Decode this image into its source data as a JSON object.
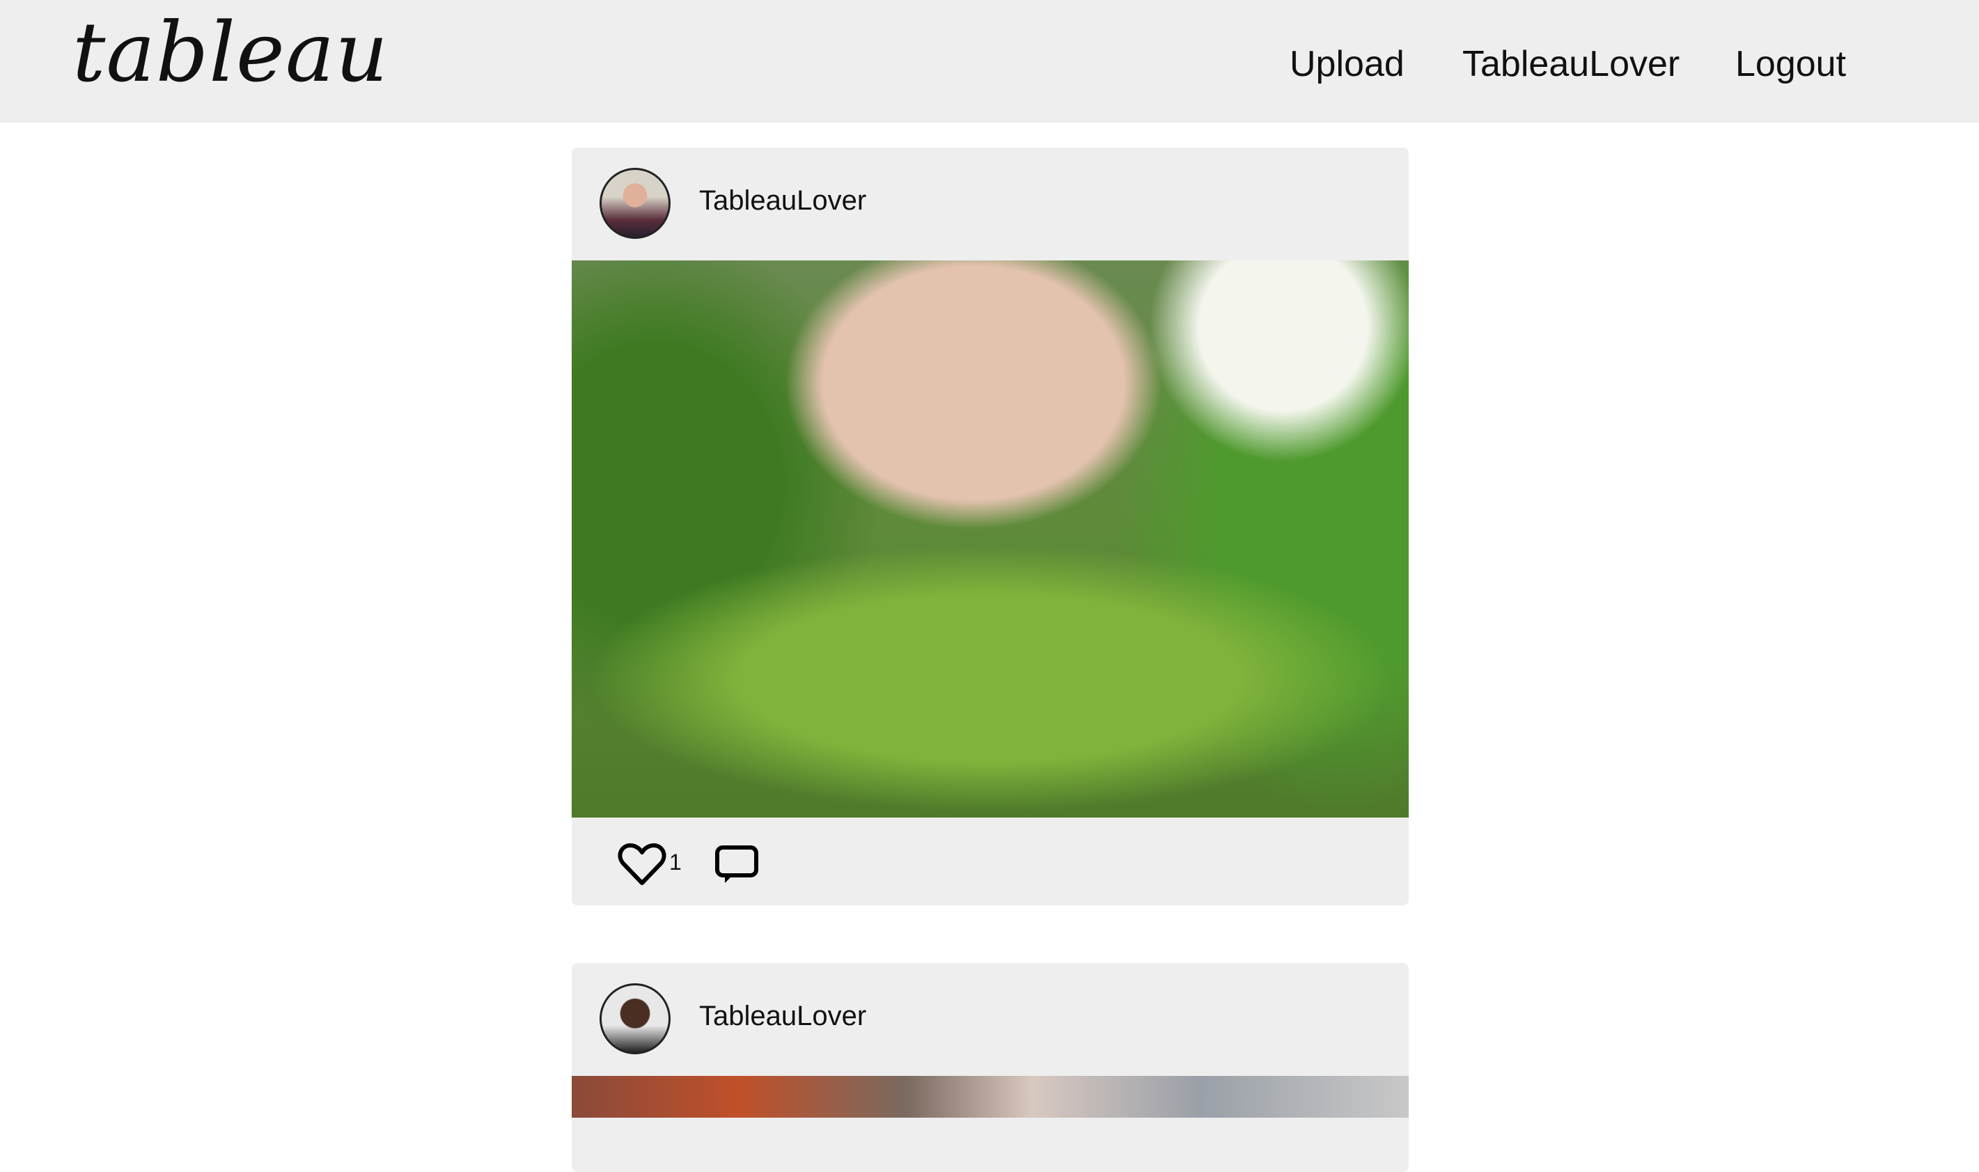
{
  "header": {
    "logo": "tableau",
    "nav": [
      "Upload",
      "TableauLover",
      "Logout"
    ]
  },
  "posts": [
    {
      "username": "TableauLover",
      "likes": "1"
    },
    {
      "username": "TableauLover"
    }
  ]
}
